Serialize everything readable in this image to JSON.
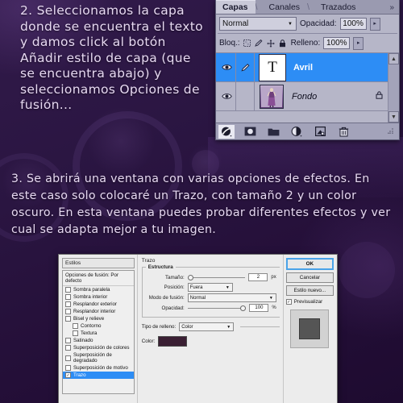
{
  "theme": {
    "page_bg": "#2a1541",
    "text_color": "#e7d9f2",
    "selection_blue": "#2d8df5",
    "stroke_color_swatch": "#3a1f33"
  },
  "notes": {
    "step2": "2. Seleccionamos la capa donde se encuentra el texto y damos click al botón Añadir estilo de capa (que se encuentra abajo) y seleccionamos Opciones de fusión...",
    "step3": "3. Se abrirá una ventana con varias opciones de efectos. En este caso solo colocaré un Trazo, con tamaño 2 y un color oscuro. En esta ventana puedes probar diferentes efectos y ver cual se adapta mejor a tu imagen."
  },
  "layers_panel": {
    "tabs": [
      {
        "label": "Capas",
        "active": true
      },
      {
        "label": "Canales",
        "active": false
      },
      {
        "label": "Trazados",
        "active": false
      }
    ],
    "tabs_more": "»",
    "blend_mode": "Normal",
    "opacity_label": "Opacidad:",
    "opacity_value": "100%",
    "lock_label": "Bloq.:",
    "fill_label": "Relleno:",
    "fill_value": "100%",
    "layers": [
      {
        "name": "Avril",
        "type": "text",
        "thumb_glyph": "T",
        "selected": true,
        "visible": true,
        "locked": false
      },
      {
        "name": "Fondo",
        "type": "image",
        "thumb_glyph": "",
        "selected": false,
        "visible": true,
        "locked": true
      }
    ],
    "footer_icons": [
      "layer-style-fx-icon",
      "layer-mask-icon",
      "new-group-folder-icon",
      "adjustment-layer-icon",
      "new-layer-icon",
      "delete-layer-trash-icon"
    ]
  },
  "dialog": {
    "styles_header": "Estilos",
    "blending_options_item": "Opciones de fusión: Por defecto",
    "effects": [
      {
        "label": "Sombra paralela",
        "checked": false,
        "indent": false,
        "selected": false
      },
      {
        "label": "Sombra interior",
        "checked": false,
        "indent": false,
        "selected": false
      },
      {
        "label": "Resplandor exterior",
        "checked": false,
        "indent": false,
        "selected": false
      },
      {
        "label": "Resplandor interior",
        "checked": false,
        "indent": false,
        "selected": false
      },
      {
        "label": "Bisel y relieve",
        "checked": false,
        "indent": false,
        "selected": false
      },
      {
        "label": "Contorno",
        "checked": false,
        "indent": true,
        "selected": false
      },
      {
        "label": "Textura",
        "checked": false,
        "indent": true,
        "selected": false
      },
      {
        "label": "Satinado",
        "checked": false,
        "indent": false,
        "selected": false
      },
      {
        "label": "Superposición de colores",
        "checked": false,
        "indent": false,
        "selected": false
      },
      {
        "label": "Superposición de degradado",
        "checked": false,
        "indent": false,
        "selected": false
      },
      {
        "label": "Superposición de motivo",
        "checked": false,
        "indent": false,
        "selected": false
      },
      {
        "label": "Trazo",
        "checked": true,
        "indent": false,
        "selected": true
      }
    ],
    "panel_title": "Trazo",
    "structure_legend": "Estructura",
    "fields": {
      "size_label": "Tamaño:",
      "size_value": "2",
      "size_unit": "px",
      "position_label": "Posición:",
      "position_value": "Fuera",
      "blend_label": "Modo de fusión:",
      "blend_value": "Normal",
      "opacity_label": "Opacidad:",
      "opacity_value": "100",
      "opacity_unit": "%",
      "fill_type_label": "Tipo de relleno:",
      "fill_type_value": "Color",
      "color_label": "Color:"
    },
    "buttons": {
      "ok": "OK",
      "cancel": "Cancelar",
      "new_style": "Estilo nuevo...",
      "preview_label": "Previsualizar",
      "preview_checked": true
    }
  }
}
